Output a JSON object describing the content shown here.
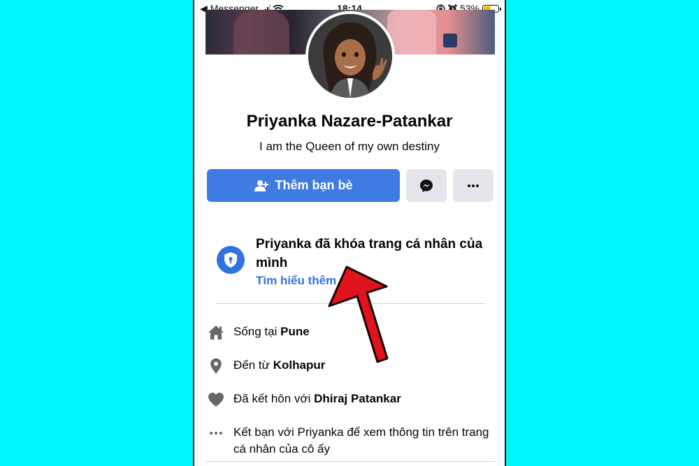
{
  "status_bar": {
    "back_app": "◀ Messenger",
    "time": "18:14",
    "battery_percent": "53%",
    "battery_level": 0.53
  },
  "profile": {
    "name": "Priyanka Nazare-Patankar",
    "bio": "I am the Queen of my own destiny"
  },
  "actions": {
    "add_friend_label": "Thêm bạn bè"
  },
  "locked_notice": {
    "title": "Priyanka đã khóa trang cá nhân của mình",
    "link": "Tìm hiểu thêm"
  },
  "intro": {
    "lives_prefix": "Sống tại ",
    "lives_place": "Pune",
    "from_prefix": "Đến từ ",
    "from_place": "Kolhapur",
    "married_prefix": "Đã kết hôn với ",
    "married_person": "Dhiraj Patankar",
    "friend_hint": "Kết bạn với Priyanka để xem thông tin trên trang cá nhân của cô ấy"
  },
  "colors": {
    "background": "#00f5fa",
    "primary_blue": "#3f7be2",
    "annotation_arrow": "#e0141e"
  },
  "icons": [
    "back-arrow-icon",
    "signal-icon",
    "wifi-icon",
    "lock-rotation-icon",
    "alarm-icon",
    "battery-icon",
    "add-friend-icon",
    "messenger-icon",
    "more-icon",
    "shield-lock-icon",
    "home-icon",
    "location-pin-icon",
    "heart-icon",
    "dots-icon"
  ]
}
